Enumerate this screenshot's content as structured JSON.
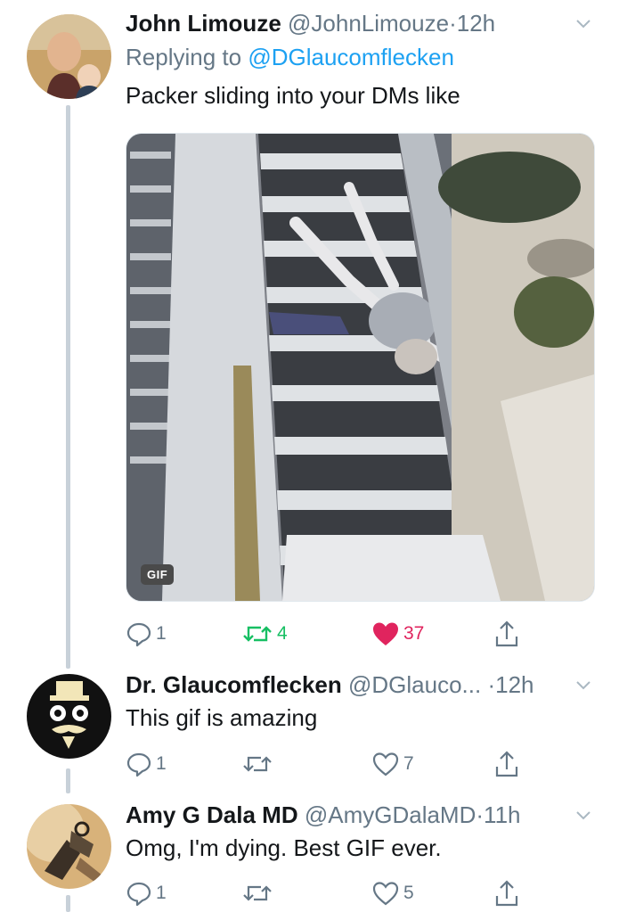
{
  "tweets": [
    {
      "name": "John Limouze",
      "handle": "@JohnLimouze",
      "dot": "·",
      "time": "12h",
      "reply_prefix": "Replying to ",
      "reply_to": "@DGlaucomflecken",
      "text": "Packer sliding into your DMs like",
      "media_badge": "GIF",
      "replies": "1",
      "retweets": "4",
      "likes": "37",
      "retweeted": true,
      "liked": true
    },
    {
      "name": "Dr. Glaucomflecken",
      "handle": "@DGlauco...",
      "dot": "·",
      "time": "12h",
      "text": "This gif is amazing",
      "replies": "1",
      "retweets": "",
      "likes": "7"
    },
    {
      "name": "Amy G Dala MD",
      "handle": "@AmyGDalaMD",
      "dot": "·",
      "time": "11h",
      "text": "Omg, I'm dying. Best GIF ever.",
      "replies": "1",
      "retweets": "",
      "likes": "5"
    }
  ],
  "colors": {
    "retweet_active": "#17bf63",
    "like_active": "#e0245e",
    "link": "#1da1f2",
    "secondary_text": "#657786",
    "thread_line": "#c8d1d9"
  }
}
